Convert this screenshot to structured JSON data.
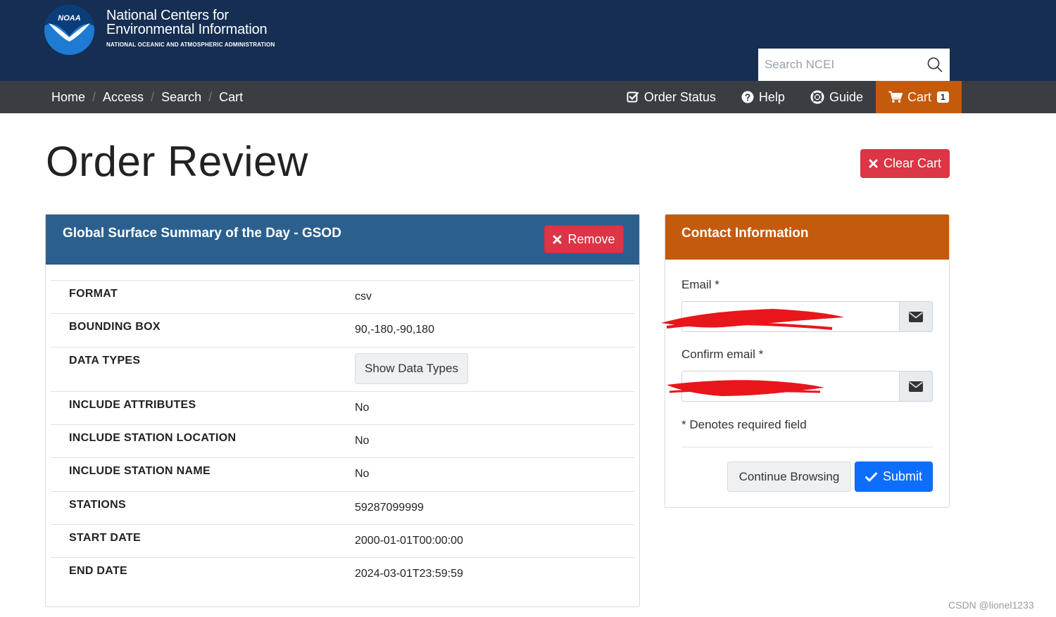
{
  "header": {
    "org_line1": "National Centers for",
    "org_line2": "Environmental Information",
    "org_line3": "NATIONAL OCEANIC AND ATMOSPHERIC ADMINISTRATION",
    "logo_text": "NOAA",
    "search_placeholder": "Search NCEI"
  },
  "breadcrumb": [
    "Home",
    "Access",
    "Search",
    "Cart"
  ],
  "nav": {
    "order_status": "Order Status",
    "help": "Help",
    "guide": "Guide",
    "cart": "Cart",
    "cart_count": "1"
  },
  "page": {
    "title": "Order Review",
    "clear_cart": "Clear Cart"
  },
  "order": {
    "title": "Global Surface Summary of the Day - GSOD",
    "remove": "Remove",
    "rows": [
      {
        "label": "FORMAT",
        "value": "csv"
      },
      {
        "label": "BOUNDING BOX",
        "value": "90,-180,-90,180"
      },
      {
        "label": "DATA TYPES",
        "button": "Show Data Types"
      },
      {
        "label": "INCLUDE ATTRIBUTES",
        "value": "No"
      },
      {
        "label": "INCLUDE STATION LOCATION",
        "value": "No"
      },
      {
        "label": "INCLUDE STATION NAME",
        "value": "No"
      },
      {
        "label": "STATIONS",
        "value": "59287099999"
      },
      {
        "label": "START DATE",
        "value": "2000-01-01T00:00:00"
      },
      {
        "label": "END DATE",
        "value": "2024-03-01T23:59:59"
      }
    ]
  },
  "contact": {
    "title": "Contact Information",
    "email_label": "Email *",
    "confirm_label": "Confirm email *",
    "email_value": "",
    "confirm_value": "",
    "required_note": "* Denotes required field",
    "continue": "Continue Browsing",
    "submit": "Submit"
  },
  "watermark": "CSDN @lionel1233",
  "colors": {
    "header_bg": "#152e52",
    "nav_bg": "#3a3d41",
    "cart_bg": "#c45a0c",
    "order_head_bg": "#2b5f8e",
    "danger": "#dc3545",
    "primary": "#0d6efd"
  }
}
